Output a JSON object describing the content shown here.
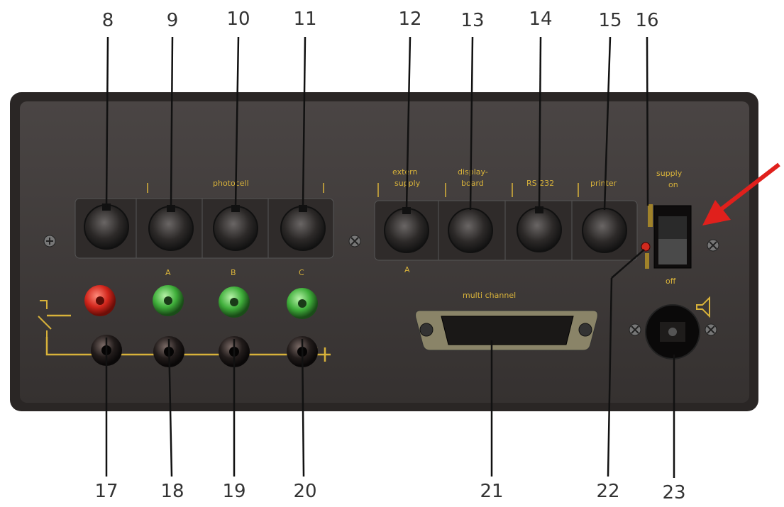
{
  "callouts": {
    "top": [
      "8",
      "9",
      "10",
      "11",
      "12",
      "13",
      "14",
      "15",
      "16"
    ],
    "bottom": [
      "17",
      "18",
      "19",
      "20",
      "21",
      "22",
      "23"
    ]
  },
  "panel_labels": {
    "photocell": "photocell",
    "extern_supply": [
      "extern",
      "supply"
    ],
    "display_board": [
      "display-",
      "board"
    ],
    "rs232": "RS 232",
    "printer": "printer",
    "supply_on": [
      "supply",
      "on"
    ],
    "off": "off",
    "multi_channel": "multi channel",
    "a_under": "A",
    "jack_top": [
      "A",
      "B",
      "C"
    ]
  },
  "colors": {
    "panel": "#3d3837",
    "label": "#d8b23a",
    "arrow": "#e0201c"
  }
}
